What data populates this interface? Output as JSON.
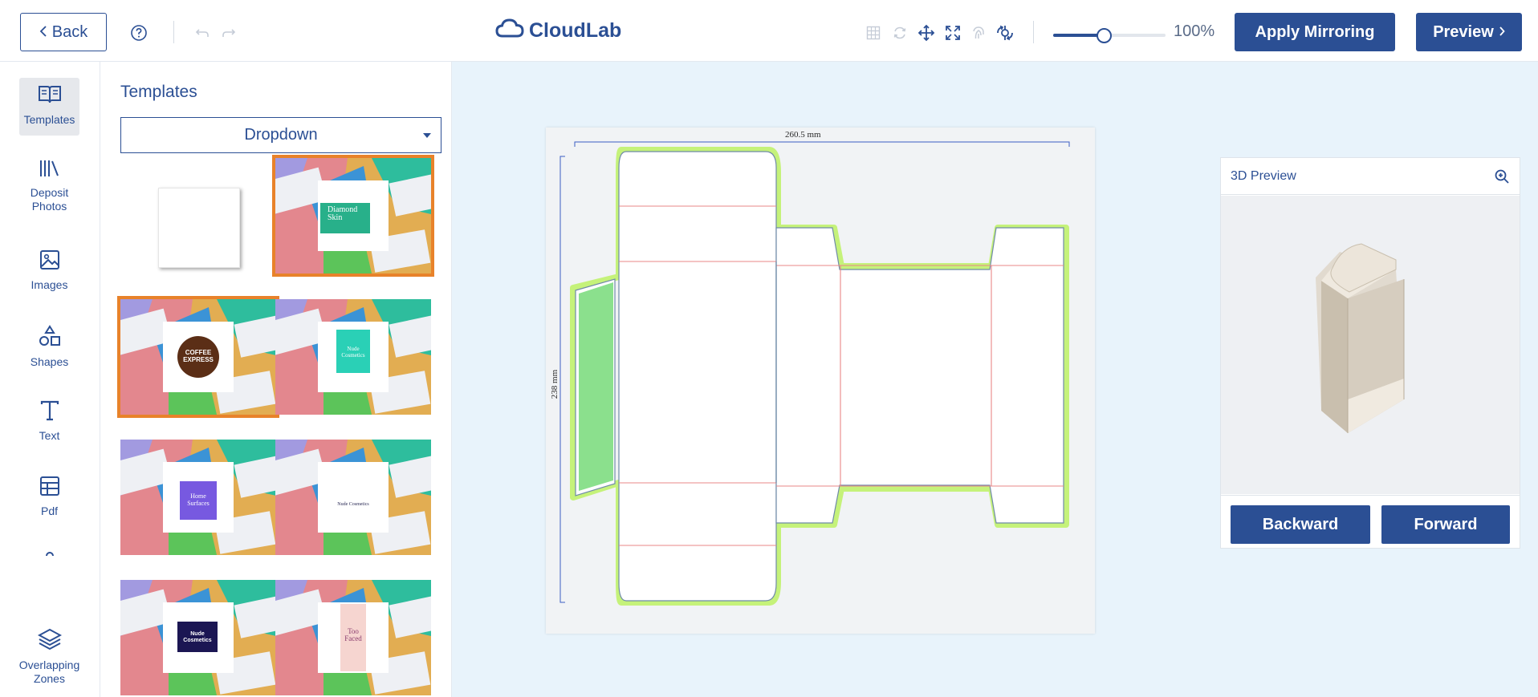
{
  "topbar": {
    "back_label": "Back",
    "help_icon": "help-circle-icon",
    "undo_icon": "undo-icon",
    "redo_icon": "redo-icon",
    "brand": "CloudLab",
    "tools": [
      "grid-icon",
      "rotate-icon",
      "move-icon",
      "fit-icon",
      "fingerprint-icon",
      "flip-icon"
    ],
    "zoom_percent": 100,
    "zoom_label": "100%",
    "zoom_slider_level": 0.45,
    "apply_label": "Apply Mirroring",
    "preview_label": "Preview",
    "accent": "#2b4f94"
  },
  "rail": {
    "items": [
      {
        "label": "Templates",
        "icon": "book-open-icon",
        "active": true
      },
      {
        "label": "Deposit Photos",
        "icon": "library-icon",
        "active": false
      },
      {
        "label": "Images",
        "icon": "image-icon",
        "active": false
      },
      {
        "label": "Shapes",
        "icon": "shapes-icon",
        "active": false
      },
      {
        "label": "Text",
        "icon": "text-icon",
        "active": false
      },
      {
        "label": "Pdf",
        "icon": "table-icon",
        "active": false
      },
      {
        "label": "Overlapping Zones",
        "icon": "layers-icon",
        "active": false
      }
    ]
  },
  "panel": {
    "title": "Templates",
    "dropdown_value": "Dropdown",
    "templates": [
      {
        "name": "blank",
        "text": "",
        "selected": false
      },
      {
        "name": "diamond-skin",
        "text": "Diamond Skin",
        "selected": true
      },
      {
        "name": "coffee-express",
        "text": "COFFEE EXPRESS",
        "selected": true
      },
      {
        "name": "nude-cosmetics-teal",
        "text": "Nude Cosmetics",
        "selected": false
      },
      {
        "name": "home-surfaces",
        "text": "Home Surfaces",
        "selected": false
      },
      {
        "name": "nude-cosmetics-white",
        "text": "Nude Cosmetics",
        "selected": false
      },
      {
        "name": "nude-cosmetics-navy",
        "text": "Nude Cosmetics",
        "selected": false
      },
      {
        "name": "too-faced",
        "text": "Too Faced",
        "selected": false
      }
    ]
  },
  "canvas": {
    "width_label": "260.5 mm",
    "height_label": "238 mm"
  },
  "preview": {
    "title": "3D Preview",
    "zoom_icon": "zoom-in-icon",
    "backward_label": "Backward",
    "forward_label": "Forward"
  }
}
